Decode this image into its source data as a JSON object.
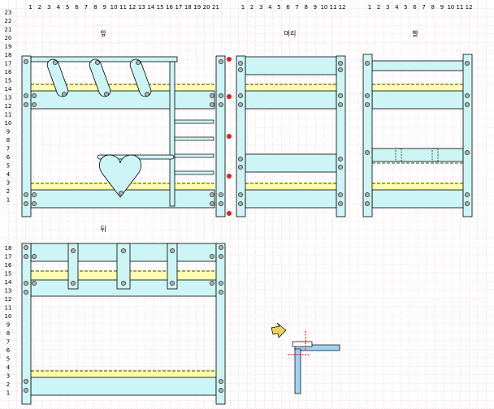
{
  "titles": {
    "front": "앞",
    "head": "머리",
    "foot": "발",
    "back": "뒤"
  },
  "front_x_labels": [
    "1",
    "2",
    "3",
    "4",
    "5",
    "6",
    "7",
    "8",
    "9",
    "10",
    "11",
    "12",
    "13",
    "14",
    "15",
    "16",
    "17",
    "18",
    "19",
    "20",
    "21"
  ],
  "front_y_labels": [
    "23",
    "22",
    "21",
    "20",
    "19",
    "18",
    "17",
    "16",
    "15",
    "14",
    "13",
    "12",
    "11",
    "10",
    "9",
    "8",
    "7",
    "6",
    "5",
    "4",
    "3",
    "2",
    "1"
  ],
  "small_x_labels": [
    "1",
    "2",
    "3",
    "4",
    "5",
    "6",
    "7",
    "8",
    "9",
    "10",
    "11",
    "12"
  ],
  "back_y_labels": [
    "18",
    "17",
    "16",
    "15",
    "14",
    "13",
    "12",
    "11",
    "10",
    "9",
    "8",
    "7",
    "6",
    "5",
    "4",
    "3",
    "2",
    "1"
  ],
  "colors": {
    "grid": "#e7a6b4",
    "panel": "#cdf5f5",
    "mattress": "#ffffb0",
    "outline": "#000000",
    "bolt": "#808080",
    "red_dot": "#e02020",
    "arrow": "#e8d45a",
    "bracket": "#9fd2f5"
  },
  "icons": {
    "heart": "heart-shape",
    "bolt": "bolt-circle",
    "arrow": "arrow-pointer"
  }
}
